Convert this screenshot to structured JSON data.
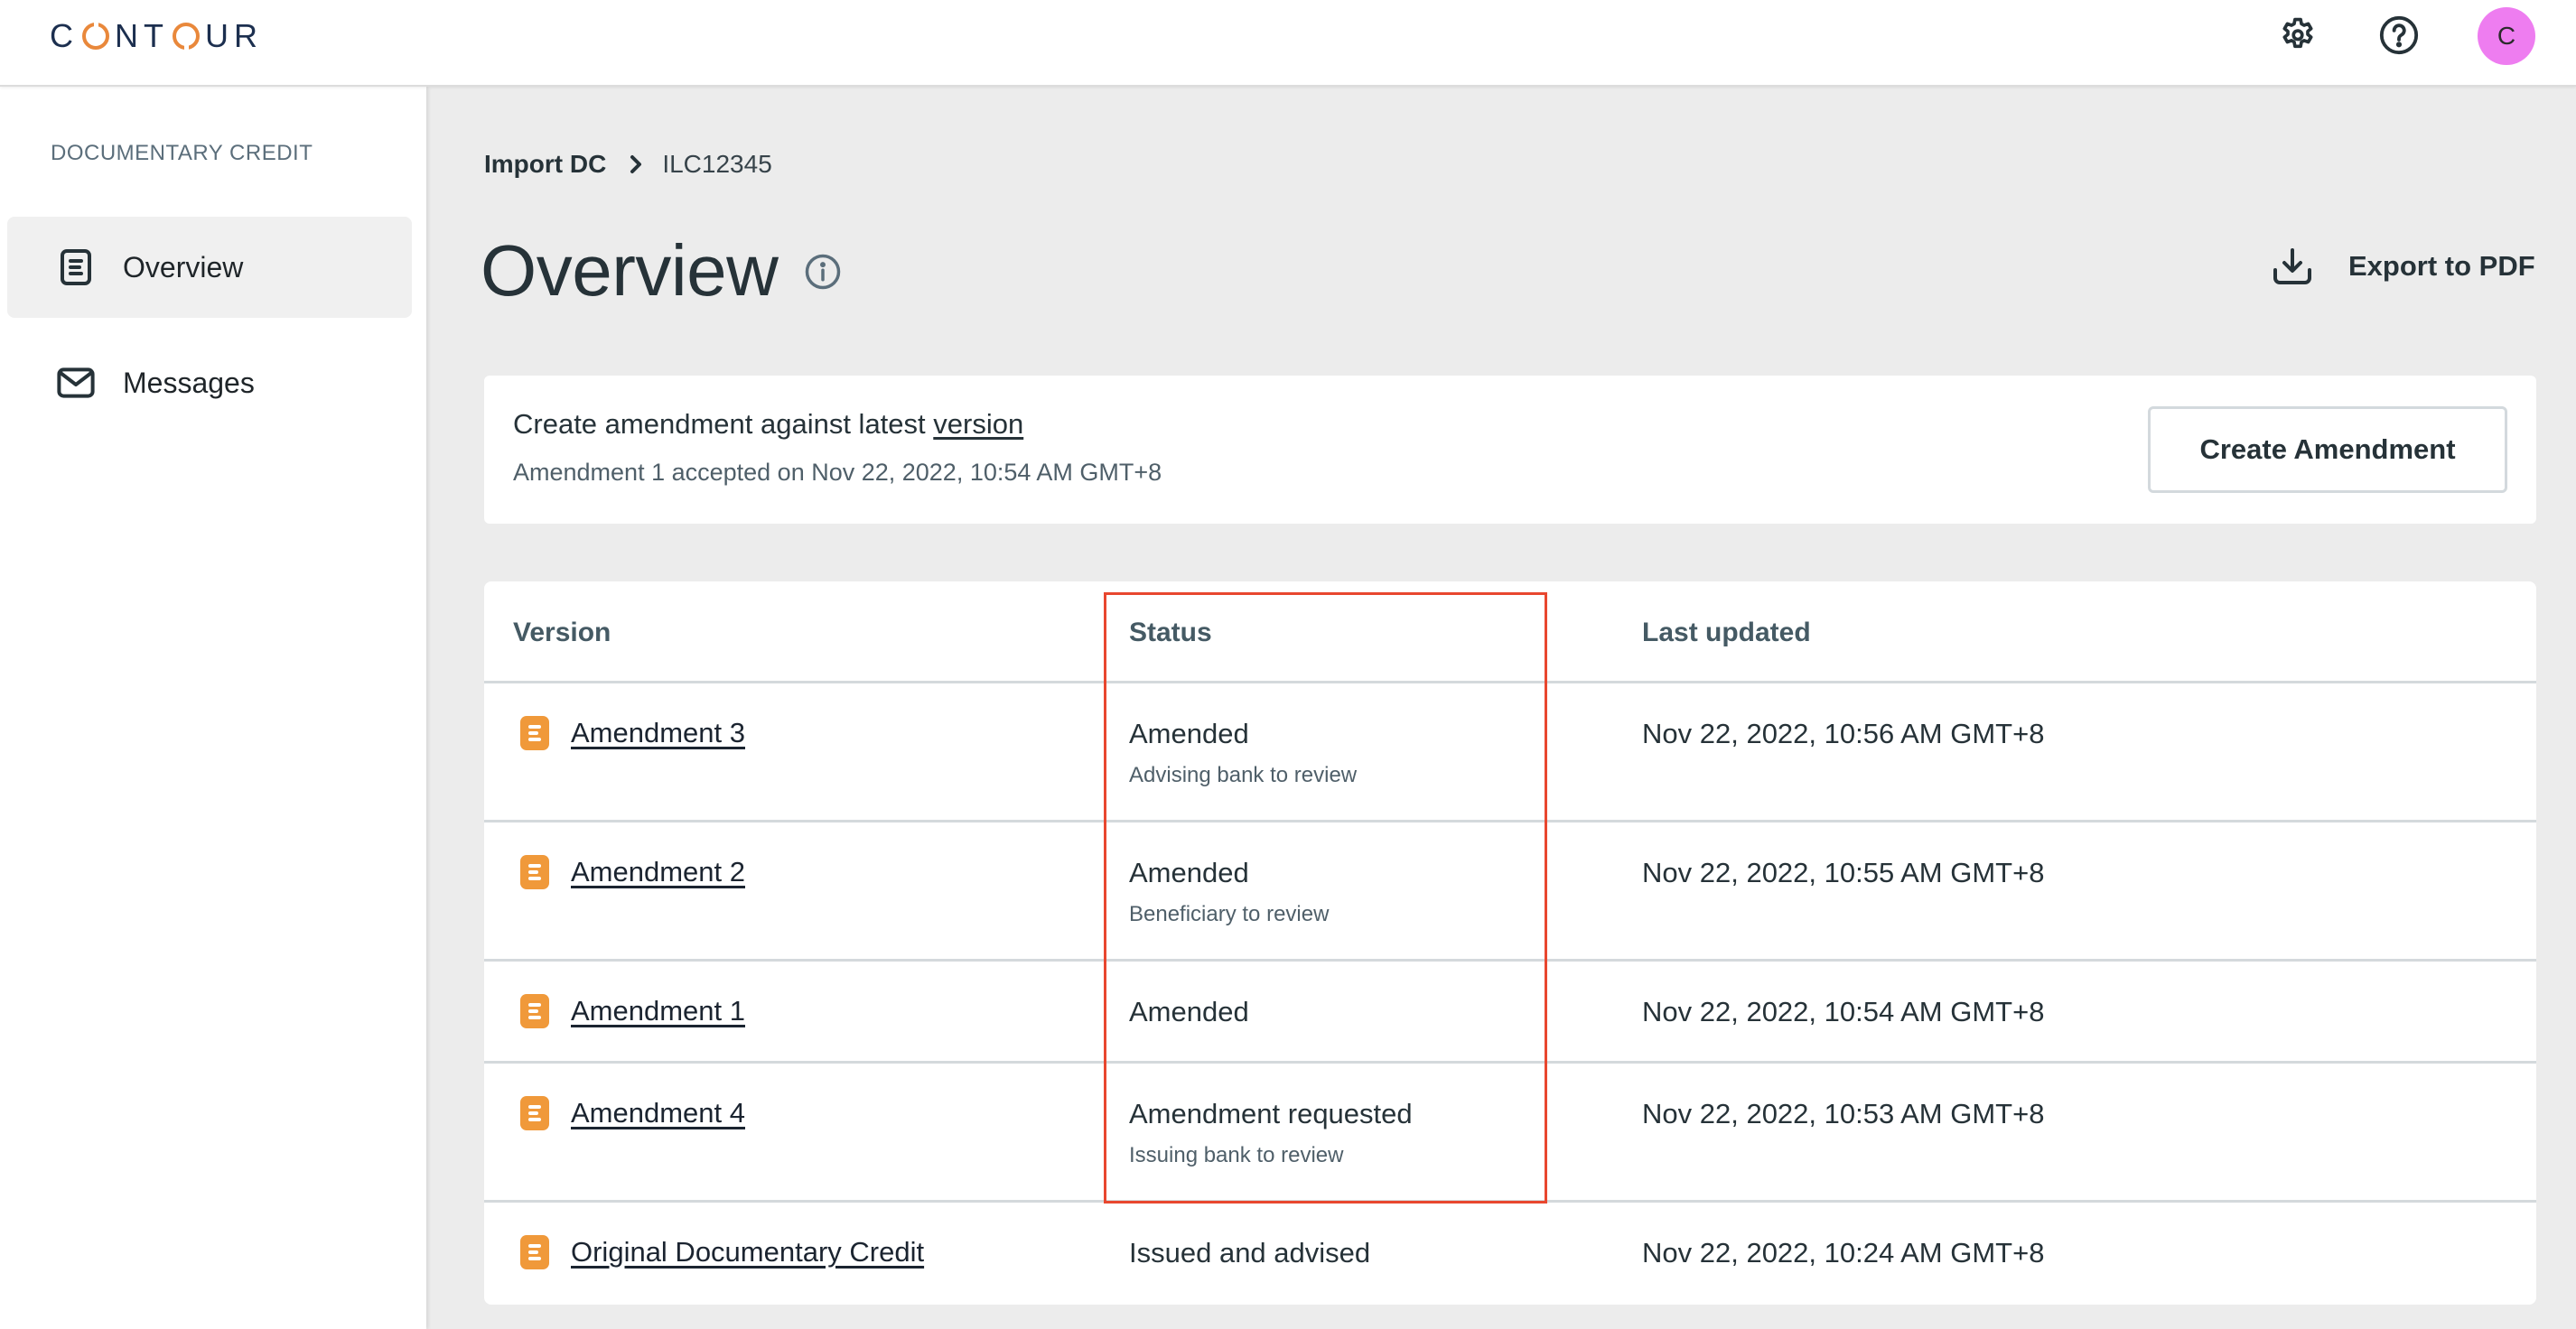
{
  "app": {
    "logo_text": [
      "C",
      "O",
      "N",
      "T",
      "O",
      "U",
      "R"
    ],
    "brand_colors": {
      "navy": "#1c2f4f",
      "orange": "#e9883b"
    }
  },
  "topbar": {
    "settings_icon": "gear-icon",
    "help_icon": "help-circle-icon",
    "avatar_initial": "C",
    "avatar_color": "#ee7df0"
  },
  "sidebar": {
    "section_label": "DOCUMENTARY CREDIT",
    "items": [
      {
        "label": "Overview",
        "icon": "document-icon",
        "active": true
      },
      {
        "label": "Messages",
        "icon": "envelope-icon",
        "active": false
      }
    ]
  },
  "breadcrumb": {
    "parent": "Import DC",
    "current": "ILC12345"
  },
  "page": {
    "title": "Overview",
    "info_icon": "info-icon",
    "export_label": "Export to PDF"
  },
  "amendment_card": {
    "title_prefix": "Create amendment against latest",
    "title_link": "version",
    "subtitle": "Amendment 1 accepted on Nov 22, 2022, 10:54 AM GMT+8",
    "button_label": "Create Amendment"
  },
  "table": {
    "headers": [
      "Version",
      "Status",
      "Last updated"
    ],
    "rows": [
      {
        "version": "Amendment 3",
        "status": "Amended",
        "status_detail": "Advising bank to review",
        "updated": "Nov 22, 2022, 10:56 AM GMT+8"
      },
      {
        "version": "Amendment 2",
        "status": "Amended",
        "status_detail": "Beneficiary to review",
        "updated": "Nov 22, 2022, 10:55 AM GMT+8"
      },
      {
        "version": "Amendment 1",
        "status": "Amended",
        "status_detail": "",
        "updated": "Nov 22, 2022, 10:54 AM GMT+8"
      },
      {
        "version": "Amendment 4",
        "status": "Amendment requested",
        "status_detail": "Issuing bank to review",
        "updated": "Nov 22, 2022, 10:53 AM GMT+8"
      },
      {
        "version": "Original Documentary Credit",
        "status": "Issued and advised",
        "status_detail": "",
        "updated": "Nov 22, 2022, 10:24 AM GMT+8"
      }
    ],
    "row_icon": "document-icon",
    "row_icon_color": "#f0993a"
  },
  "annotation": {
    "highlight_color": "#e8472f",
    "highlighted_column": "Status"
  }
}
